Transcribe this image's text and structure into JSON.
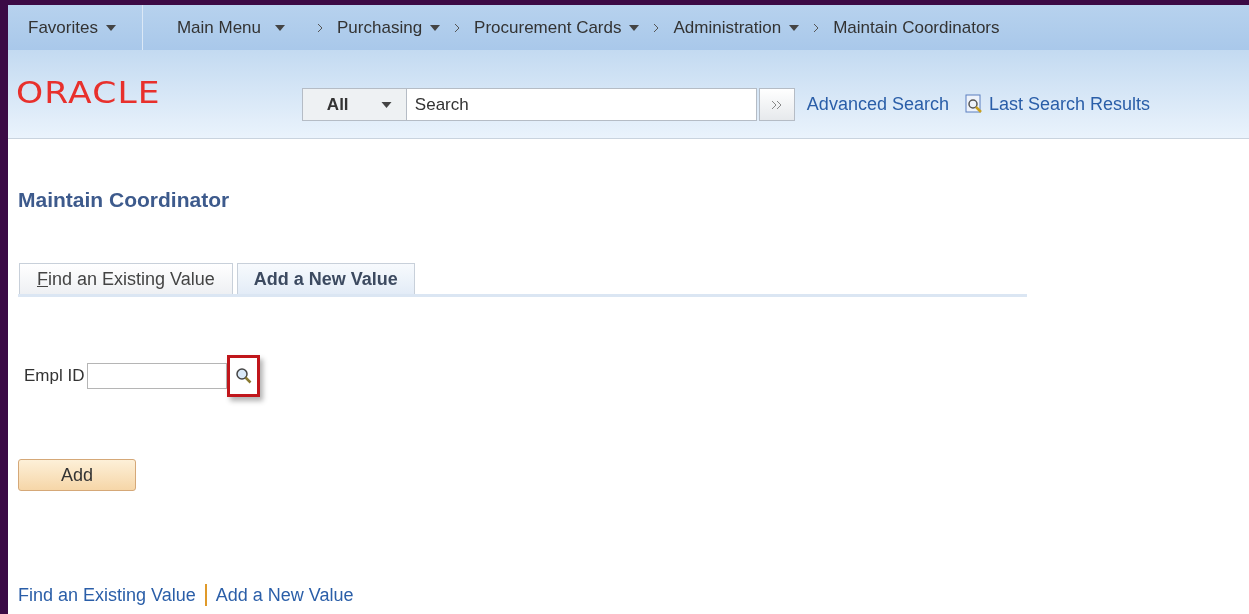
{
  "nav": {
    "favorites": "Favorites",
    "items": [
      {
        "label": "Main Menu",
        "dropdown": true
      },
      {
        "label": "Purchasing",
        "dropdown": true
      },
      {
        "label": "Procurement Cards",
        "dropdown": true
      },
      {
        "label": "Administration",
        "dropdown": true
      },
      {
        "label": "Maintain Coordinators",
        "dropdown": false
      }
    ]
  },
  "header": {
    "logo": "ORACLE",
    "search_scope": "All",
    "search": {
      "placeholder": "Search"
    },
    "advanced_search": "Advanced Search",
    "last_search_results": "Last Search Results"
  },
  "page_title": "Maintain Coordinator",
  "tabs": [
    {
      "label": "Find an Existing Value",
      "selected": false
    },
    {
      "label": "Add a New Value",
      "selected": true
    }
  ],
  "field": {
    "label": "Empl ID"
  },
  "add_button": "Add",
  "footer_links": [
    "Find an Existing Value",
    "Add a New Value"
  ]
}
